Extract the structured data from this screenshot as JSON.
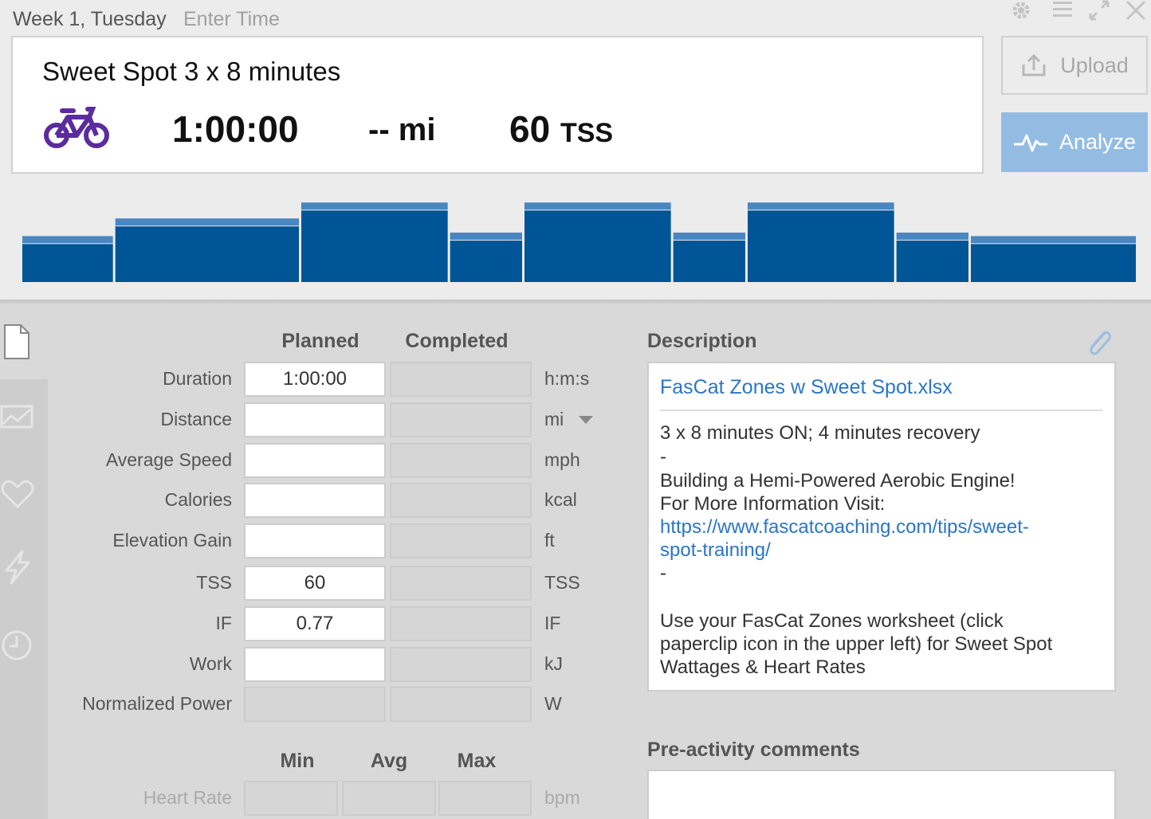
{
  "header": {
    "date": "Week 1, Tuesday",
    "enter_time": "Enter Time"
  },
  "summary": {
    "title": "Sweet Spot 3 x 8 minutes",
    "sport_icon": "bike-icon",
    "duration": "1:00:00",
    "distance": "-- mi",
    "tss_value": "60",
    "tss_unit": "TSS"
  },
  "buttons": {
    "upload": "Upload",
    "analyze": "Analyze"
  },
  "window_icons": [
    "gear-icon",
    "menu-icon",
    "expand-icon",
    "close-icon"
  ],
  "colors": {
    "bar_fill": "#005596",
    "bar_cap": "#4a86c0",
    "analyze_bg": "#94bce3",
    "link": "#2a76c6",
    "sport_icon": "#5b2c9e"
  },
  "workout_structure": {
    "segments": [
      {
        "minutes": 5,
        "intensity": 0.52
      },
      {
        "minutes": 10,
        "intensity": 0.72
      },
      {
        "minutes": 8,
        "intensity": 0.9
      },
      {
        "minutes": 4,
        "intensity": 0.56
      },
      {
        "minutes": 8,
        "intensity": 0.9
      },
      {
        "minutes": 4,
        "intensity": 0.56
      },
      {
        "minutes": 8,
        "intensity": 0.9
      },
      {
        "minutes": 4,
        "intensity": 0.56
      },
      {
        "minutes": 9,
        "intensity": 0.52
      }
    ]
  },
  "sidebar": {
    "icons": [
      "document-icon",
      "chart-icon",
      "heart-icon",
      "lightning-icon",
      "clock-icon"
    ]
  },
  "metrics": {
    "col_planned": "Planned",
    "col_completed": "Completed",
    "rows": [
      {
        "label": "Duration",
        "planned": "1:00:00",
        "completed": "",
        "unit": "h:m:s"
      },
      {
        "label": "Distance",
        "planned": "",
        "completed": "",
        "unit": "mi"
      },
      {
        "label": "Average Speed",
        "planned": "",
        "completed": "",
        "unit": "mph"
      },
      {
        "label": "Calories",
        "planned": "",
        "completed": "",
        "unit": "kcal"
      },
      {
        "label": "Elevation Gain",
        "planned": "",
        "completed": "",
        "unit": "ft"
      },
      {
        "label": "TSS",
        "planned": "60",
        "completed": "",
        "unit": "TSS"
      },
      {
        "label": "IF",
        "planned": "0.77",
        "completed": "",
        "unit": "IF"
      },
      {
        "label": "Work",
        "planned": "",
        "completed": "",
        "unit": "kJ"
      },
      {
        "label": "Normalized Power",
        "planned": "",
        "completed": "",
        "unit": "W"
      }
    ],
    "hr_cols": {
      "min": "Min",
      "avg": "Avg",
      "max": "Max"
    },
    "hr_label": "Heart Rate",
    "hr_unit": "bpm"
  },
  "description": {
    "heading": "Description",
    "file_link": "FasCat Zones w Sweet Spot.xlsx",
    "line1": "3 x 8 minutes ON; 4 minutes recovery",
    "dash1": "-",
    "line2": "Building a Hemi-Powered Aerobic Engine!",
    "line3": "For More Information Visit:",
    "url1": "https://www.fascatcoaching.com/tips/sweet-",
    "url2": "spot-training/",
    "dash2": "-",
    "line4": "Use your FasCat Zones worksheet (click",
    "line5": "paperclip icon in the upper left) for Sweet Spot",
    "line6": "Wattages & Heart Rates"
  },
  "pre_activity": {
    "heading": "Pre-activity comments"
  }
}
